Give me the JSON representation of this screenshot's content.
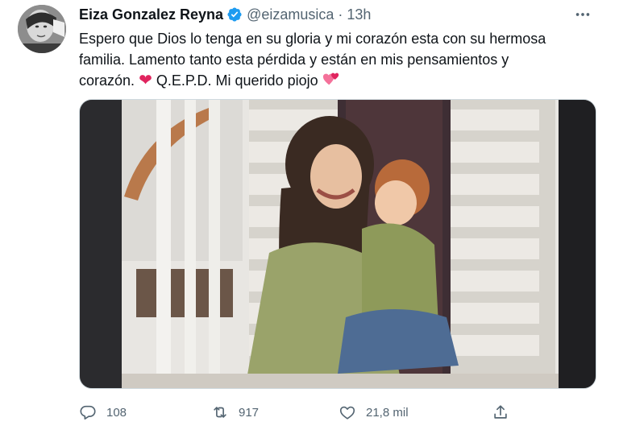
{
  "author": {
    "display_name": "Eiza Gonzalez Reyna",
    "handle": "@eizamusica",
    "separator": "·",
    "timestamp": "13h",
    "verified": true
  },
  "tweet": {
    "text_line1": "Espero que Dios lo tenga en su gloria y mi corazón esta con su hermosa",
    "text_line2": "familia. Lamento tanto esta pérdida y están en mis pensamientos y",
    "text_line3_a": "corazón.",
    "text_line3_b": "Q.E.P.D. Mi querido piojo",
    "heart_emoji": "❤",
    "hearts_emoji_name": "two-hearts"
  },
  "actions": {
    "reply_count": "108",
    "retweet_count": "917",
    "like_count": "21,8 mil"
  },
  "icons": {
    "more": "more-icon",
    "reply": "reply-icon",
    "retweet": "retweet-icon",
    "like": "like-icon",
    "share": "share-icon"
  },
  "colors": {
    "verified": "#1d9bf0",
    "secondary_text": "#536471",
    "heart": "#e0245e",
    "border": "#cfd9de"
  }
}
